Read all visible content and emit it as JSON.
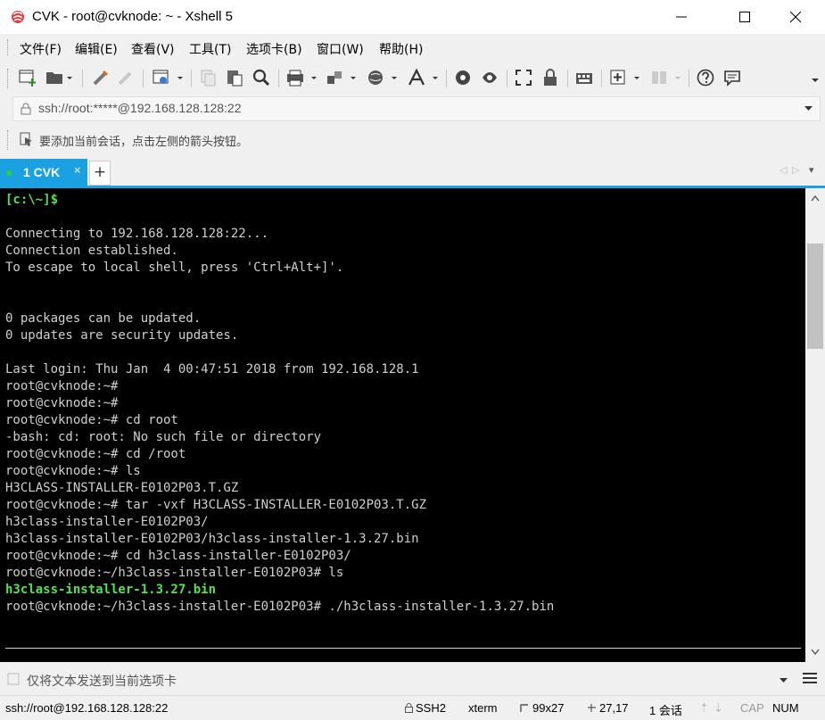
{
  "window": {
    "title": "CVK - root@cvknode: ~ - Xshell 5",
    "accent": "#1ba1e2"
  },
  "menu": {
    "items": [
      "文件(F)",
      "编辑(E)",
      "查看(V)",
      "工具(T)",
      "选项卡(B)",
      "窗口(W)",
      "帮助(H)"
    ]
  },
  "address": {
    "text": "ssh://root:*****@192.168.128.128:22"
  },
  "hint": {
    "text": "要添加当前会话，点击左侧的箭头按钮。"
  },
  "tabs": {
    "active_label": "1 CVK",
    "close": "×",
    "add": "+"
  },
  "terminal": {
    "prompt_header": "[c:\\~]$",
    "lines": [
      "Connecting to 192.168.128.128:22...",
      "Connection established.",
      "To escape to local shell, press 'Ctrl+Alt+]'.",
      "0 packages can be updated.",
      "0 updates are security updates.",
      "Last login: Thu Jan  4 00:47:51 2018 from 192.168.128.1",
      "root@cvknode:~#",
      "root@cvknode:~#",
      "root@cvknode:~# cd root",
      "-bash: cd: root: No such file or directory",
      "root@cvknode:~# cd /root",
      "root@cvknode:~# ls",
      "H3CLASS-INSTALLER-E0102P03.T.GZ",
      "root@cvknode:~# tar -vxf H3CLASS-INSTALLER-E0102P03.T.GZ",
      "h3class-installer-E0102P03/",
      "h3class-installer-E0102P03/h3class-installer-1.3.27.bin",
      "root@cvknode:~# cd h3class-installer-E0102P03/",
      "root@cvknode:~/h3class-installer-E0102P03# ls",
      "h3class-installer-1.3.27.bin",
      "root@cvknode:~/h3class-installer-E0102P03# ./h3class-installer-1.3.27.bin"
    ]
  },
  "sendbar": {
    "placeholder": "仅将文本发送到当前选项卡"
  },
  "status": {
    "connection": "ssh://root@192.168.128.128:22",
    "protocol": "SSH2",
    "terminal_type": "xterm",
    "size": "99x27",
    "cursor": "27,17",
    "sessions": "1 会话",
    "cap": "CAP",
    "num": "NUM"
  }
}
